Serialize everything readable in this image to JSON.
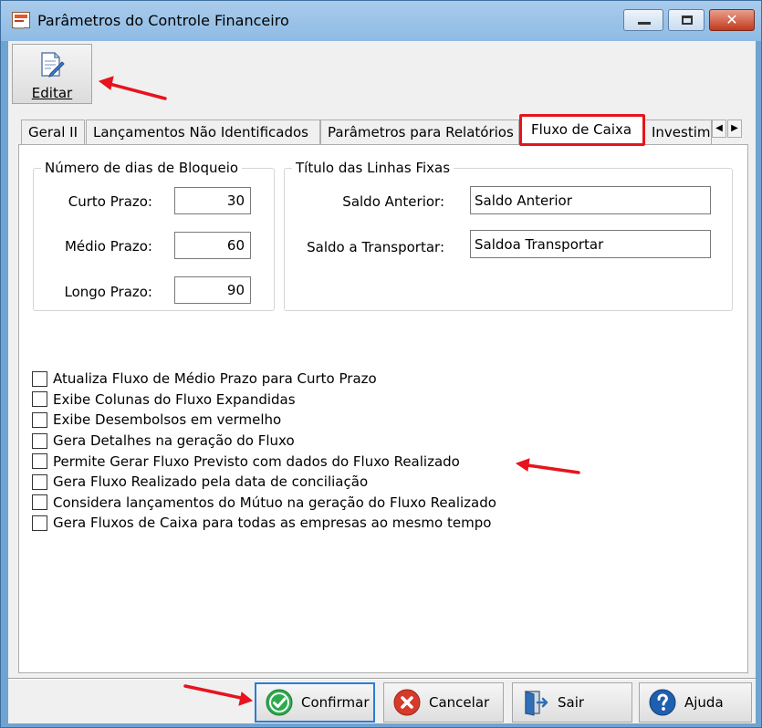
{
  "window": {
    "title": "Parâmetros do Controle Financeiro",
    "close_glyph": "✕"
  },
  "toolbar": {
    "edit_label": "Editar",
    "edit_icon": "edit-document-icon"
  },
  "tabs": [
    {
      "label": "Geral II",
      "active": false
    },
    {
      "label": "Lançamentos Não Identificados",
      "active": false
    },
    {
      "label": "Parâmetros para Relatórios",
      "active": false
    },
    {
      "label": "Fluxo de Caixa",
      "active": true
    },
    {
      "label": "Investim",
      "active": false
    }
  ],
  "tab_scroll": {
    "left": "◀",
    "right": "▶"
  },
  "blocking_days": {
    "title": "Número de dias de Bloqueio",
    "short_label": "Curto Prazo:",
    "short_value": "30",
    "medium_label": "Médio Prazo:",
    "medium_value": "60",
    "long_label": "Longo Prazo:",
    "long_value": "90"
  },
  "fixed_lines": {
    "title": "Título das Linhas Fixas",
    "previous_label": "Saldo Anterior:",
    "previous_value": "Saldo Anterior",
    "carry_label": "Saldo a Transportar:",
    "carry_value": "Saldoa Transportar"
  },
  "options": [
    {
      "label": "Atualiza Fluxo de Médio Prazo para Curto Prazo",
      "checked": false
    },
    {
      "label": "Exibe Colunas do Fluxo Expandidas",
      "checked": false
    },
    {
      "label": "Exibe Desembolsos  em vermelho",
      "checked": false
    },
    {
      "label": "Gera Detalhes na geração do Fluxo",
      "checked": false
    },
    {
      "label": "Permite Gerar Fluxo Previsto com dados do Fluxo Realizado",
      "checked": false
    },
    {
      "label": "Gera Fluxo Realizado pela data de conciliação",
      "checked": false
    },
    {
      "label": "Considera lançamentos do Mútuo na geração do Fluxo Realizado",
      "checked": false
    },
    {
      "label": "Gera Fluxos de Caixa para todas as empresas ao mesmo tempo",
      "checked": false
    }
  ],
  "buttons": {
    "confirm": "Confirmar",
    "cancel": "Cancelar",
    "exit": "Sair",
    "help": "Ajuda"
  },
  "colors": {
    "annotation_red": "#e6141e",
    "primary_focus": "#2a7dd4",
    "confirm_green": "#2eaa4f",
    "cancel_red": "#d63a2a",
    "help_blue": "#1f5fb0"
  }
}
